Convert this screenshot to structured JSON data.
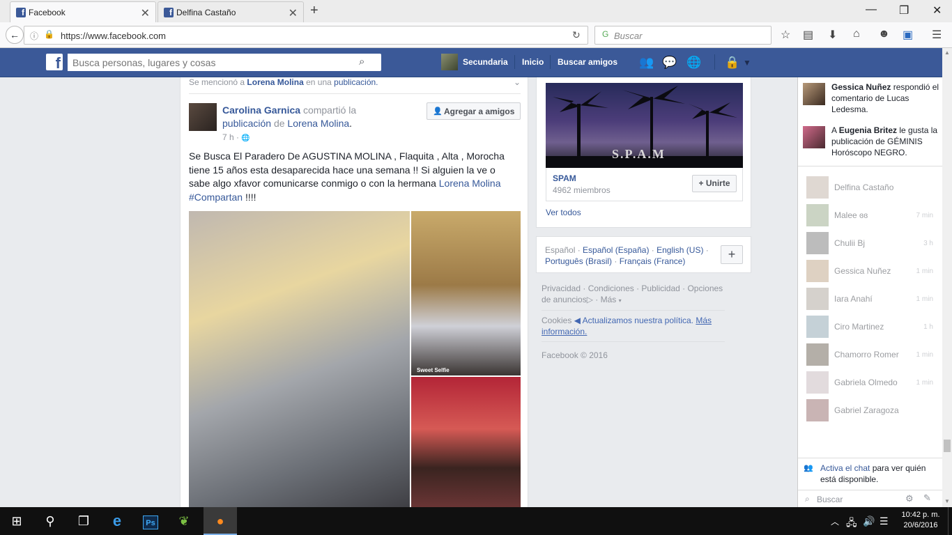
{
  "browser": {
    "tabs": [
      {
        "label": "Facebook",
        "active": true
      },
      {
        "label": "Delfina Castaño",
        "active": false
      }
    ],
    "new_tab": "+",
    "url": "https://www.facebook.com",
    "search_placeholder": "Buscar"
  },
  "fb_header": {
    "logo": "f",
    "search_placeholder": "Busca personas, lugares y cosas",
    "profile_name": "Secundaria",
    "nav": [
      "Inicio",
      "Buscar amigos"
    ]
  },
  "post": {
    "mentioned_prefix": "Se mencionó a",
    "mentioned_name": "Lorena Molina",
    "mentioned_mid": "en una",
    "mentioned_link": "publicación.",
    "author": "Carolina Garnica",
    "shared": "compartió la",
    "shared_link": "publicación",
    "shared_of": "de",
    "shared_owner": "Lorena Molina",
    "time": "7 h ·",
    "add_friend": "Agregar a amigos",
    "text_body": "Se Busca El Paradero De AGUSTINA MOLINA , Flaquita , Alta , Morocha tiene 15 años esta desaparecida hace una semana !! Si alguien la ve o sabe algo xfavor comunicarse conmigo o con la hermana",
    "text_mention": "Lorena Molina",
    "text_hashtag": "#Compartan",
    "text_end": "!!!!",
    "selfie_label": "Sweet Selfie"
  },
  "right_col": {
    "group_banner_text": "S.P.A.M",
    "group_name": "SPAM",
    "group_members": "4962 miembros",
    "join_label": "+ Unirte",
    "see_all": "Ver todos",
    "languages": [
      "Español",
      "Español (España)",
      "English (US)",
      "Português (Brasil)",
      "Français (France)"
    ],
    "lang_plus": "+",
    "footer_links": [
      "Privacidad",
      "Condiciones",
      "Publicidad",
      "Opciones de anuncios",
      "Más"
    ],
    "cookies_label": "Cookies",
    "cookies_link": "◀ Actualizamos nuestra política.",
    "cookies_more": "Más información.",
    "copyright": "Facebook © 2016"
  },
  "ticker": [
    {
      "name": "Gessica Nuñez",
      "text": " respondió el comentario de Lucas Ledesma."
    },
    {
      "prefix": "A ",
      "name": "Eugenia Britez",
      "text": " le gusta la publicación de GÉMINIS Horóscopo NEGRO."
    }
  ],
  "chat": [
    {
      "name": "Delfina Castaño",
      "time": ""
    },
    {
      "name": "Malee ɞɞ",
      "time": "7 min"
    },
    {
      "name": "Chulii Bj",
      "time": "3 h"
    },
    {
      "name": "Gessica Nuñez",
      "time": "1 min"
    },
    {
      "name": "Iara Anahí",
      "time": "1 min"
    },
    {
      "name": "Ciro Martinez",
      "time": "1 h"
    },
    {
      "name": "Chamorro Romer",
      "time": "1 min"
    },
    {
      "name": "Gabriela Olmedo",
      "time": "1 min"
    },
    {
      "name": "Gabriel Zaragoza",
      "time": ""
    }
  ],
  "chat_footer": {
    "activate_link": "Activa el chat",
    "activate_text": " para ver quién está disponible.",
    "search_placeholder": "Buscar"
  },
  "taskbar": {
    "ps_label": "Ps",
    "time": "10:42 p. m.",
    "date": "20/6/2016"
  }
}
